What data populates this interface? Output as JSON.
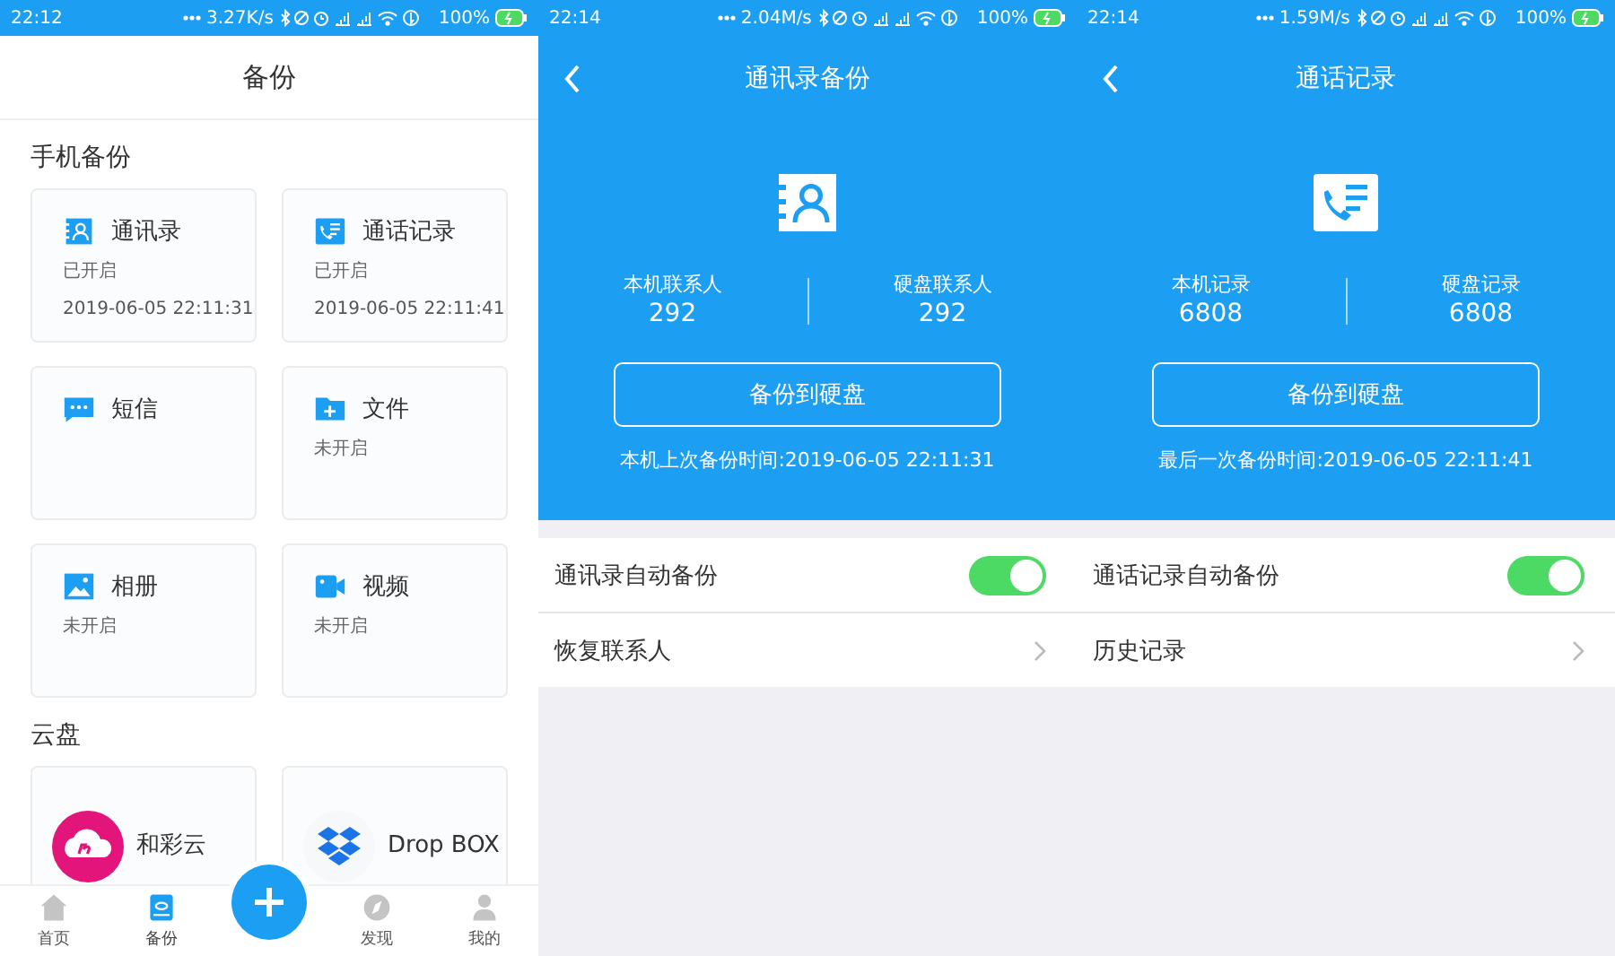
{
  "screens": [
    {
      "kind": "home",
      "status_bar": {
        "time": "22:12",
        "speed": "3.27K/s",
        "battery": "100%"
      },
      "title": "备份",
      "sections": [
        {
          "title": "手机备份",
          "cards": [
            {
              "kind": "contacts",
              "label": "通讯录",
              "status": "已开启",
              "time": "2019-06-05 22:11:31"
            },
            {
              "kind": "calls",
              "label": "通话记录",
              "status": "已开启",
              "time": "2019-06-05 22:11:41"
            },
            {
              "kind": "sms",
              "label": "短信"
            },
            {
              "kind": "folder",
              "label": "文件",
              "status": "未开启"
            },
            {
              "kind": "photo",
              "label": "相册",
              "status": "未开启"
            },
            {
              "kind": "video",
              "label": "视频",
              "status": "未开启"
            }
          ]
        },
        {
          "title": "云盘",
          "cards": [
            {
              "kind": "cloud",
              "label": "和彩云"
            },
            {
              "kind": "boxes",
              "label": "Drop BOX"
            }
          ]
        }
      ],
      "nav": [
        {
          "kind": "home",
          "label": "首页",
          "selected": false
        },
        {
          "kind": "drive",
          "label": "备份",
          "selected": true
        },
        {
          "kind": "compass",
          "label": "发现",
          "selected": false
        },
        {
          "kind": "person",
          "label": "我的",
          "selected": false
        }
      ]
    },
    {
      "kind": "detail",
      "status_bar": {
        "time": "22:14",
        "speed": "2.04M/s",
        "battery": "100%"
      },
      "title": "通讯录备份",
      "hero": {
        "kind": "contacts"
      },
      "stats": [
        {
          "label": "本机联系人",
          "value": "292"
        },
        {
          "label": "硬盘联系人",
          "value": "292"
        }
      ],
      "button": "备份到硬盘",
      "note": "本机上次备份时间:2019-06-05 22:11:31",
      "rows": [
        {
          "kind": "toggle",
          "label": "通讯录自动备份",
          "on": true
        },
        {
          "kind": "link",
          "label": "恢复联系人"
        }
      ]
    },
    {
      "kind": "detail",
      "status_bar": {
        "time": "22:14",
        "speed": "1.59M/s",
        "battery": "100%"
      },
      "title": "通话记录",
      "hero": {
        "kind": "calls"
      },
      "stats": [
        {
          "label": "本机记录",
          "value": "6808"
        },
        {
          "label": "硬盘记录",
          "value": "6808"
        }
      ],
      "button": "备份到硬盘",
      "note": "最后一次备份时间:2019-06-05 22:11:41",
      "rows": [
        {
          "kind": "toggle",
          "label": "通话记录自动备份",
          "on": true
        },
        {
          "kind": "link",
          "label": "历史记录"
        }
      ]
    }
  ]
}
